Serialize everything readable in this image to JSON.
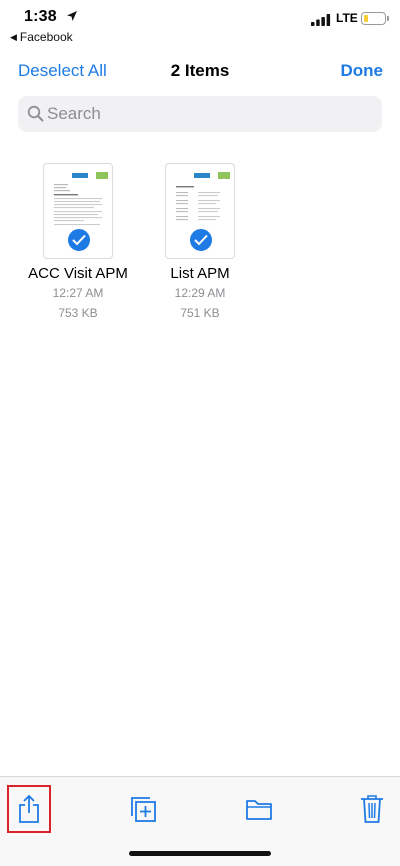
{
  "status_bar": {
    "time": "1:38",
    "back_app": "Facebook",
    "network": "LTE",
    "battery_level": 0.2,
    "colors": {
      "battery": "#f6cc35"
    }
  },
  "nav": {
    "left_label": "Deselect All",
    "title": "2 Items",
    "right_label": "Done",
    "accent_color": "#1e7be6"
  },
  "search": {
    "placeholder": "Search",
    "value": ""
  },
  "files": [
    {
      "name": "ACC Visit APM",
      "time": "12:27 AM",
      "size": "753 KB",
      "selected": true
    },
    {
      "name": "List APM",
      "time": "12:29 AM",
      "size": "751 KB",
      "selected": true
    }
  ],
  "toolbar": {
    "items": [
      {
        "icon": "share-icon",
        "highlighted": true
      },
      {
        "icon": "duplicate-icon"
      },
      {
        "icon": "folder-icon"
      },
      {
        "icon": "trash-icon"
      }
    ]
  }
}
